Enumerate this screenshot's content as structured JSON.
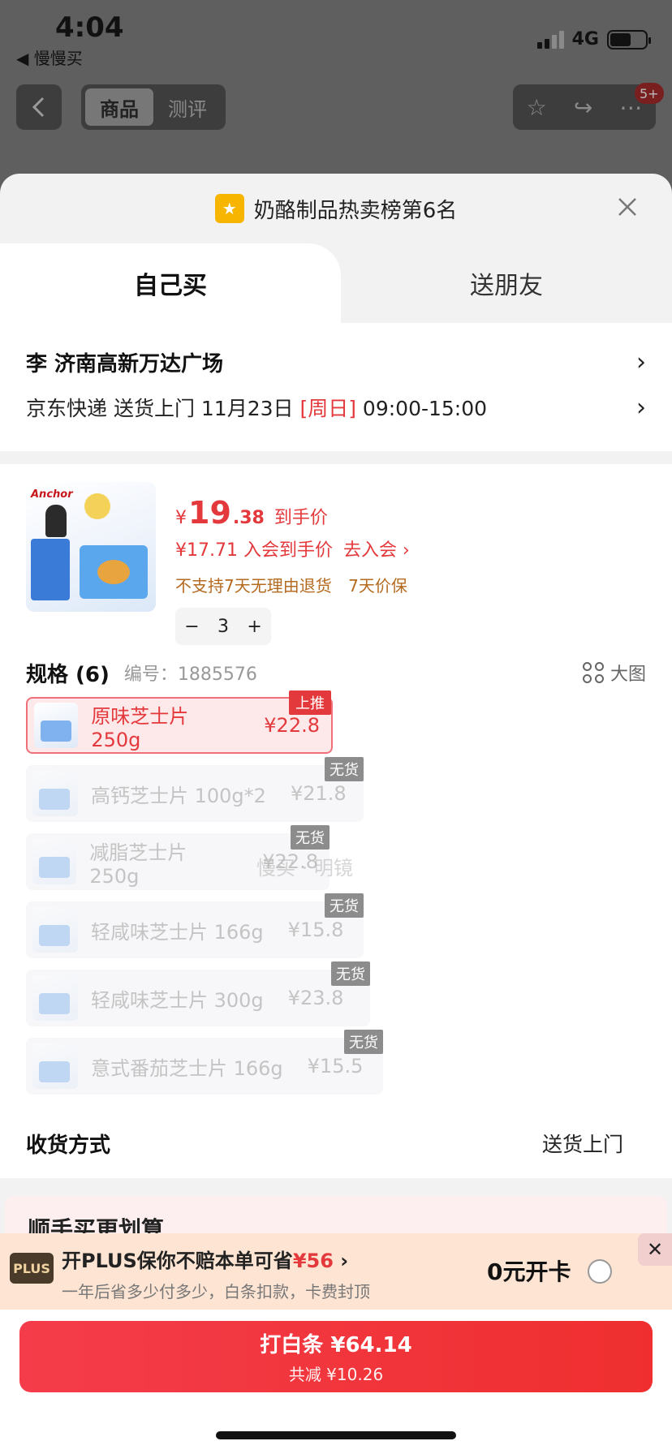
{
  "status": {
    "time": "4:04",
    "back_app": "◀ 慢慢买",
    "network": "4G"
  },
  "nav": {
    "tabs": [
      "商品",
      "测评"
    ],
    "badge": "5+"
  },
  "sheet": {
    "rank_text": "奶酪制品热卖榜第6名",
    "tabs": {
      "self": "自己买",
      "friend": "送朋友"
    },
    "address": {
      "name": "李  济南高新万达广场"
    },
    "delivery": {
      "prefix": "京东快递 送货上门 11月23日 ",
      "day": "[周日]",
      "time": " 09:00-15:00"
    },
    "product": {
      "price_yen": "¥",
      "price_int": "19",
      "price_dec": ".38",
      "price_tag": "到手价",
      "member_price": "¥17.71 入会到手价",
      "member_link": "去入会 ›",
      "policy_1": "不支持7天无理由退货",
      "policy_2": "7天价保",
      "quantity": "3",
      "image_logo": "Anchor"
    },
    "spec": {
      "title": "规格 (6)",
      "number": "编号：1885576",
      "big_image": "大图",
      "items": [
        {
          "name": "原味芝士片 250g",
          "price": "¥22.8",
          "tag": "上推",
          "available": true
        },
        {
          "name": "高钙芝士片 100g*2",
          "price": "¥21.8",
          "tag": "无货",
          "available": false
        },
        {
          "name": "减脂芝士片 250g",
          "price": "¥22.8",
          "tag": "无货",
          "available": false
        },
        {
          "name": "轻咸味芝士片 166g",
          "price": "¥15.8",
          "tag": "无货",
          "available": false
        },
        {
          "name": "轻咸味芝士片 300g",
          "price": "¥23.8",
          "tag": "无货",
          "available": false
        },
        {
          "name": "意式番茄芝士片 166g",
          "price": "¥15.5",
          "tag": "无货",
          "available": false
        }
      ],
      "watermark": "慢买 · 明镜"
    },
    "shipping": {
      "label": "收货方式",
      "value": "送货上门"
    },
    "promo_title": "顺手买更划算"
  },
  "plus": {
    "logo": "PLUS",
    "main": "开PLUS保你不赔本单可省",
    "amount": "¥56",
    "sub": "一年后省多少付多少，白条扣款，卡费封顶",
    "open": "0元开卡"
  },
  "pay": {
    "main": "打白条 ¥64.14",
    "sub": "共减 ¥10.26"
  },
  "colors": {
    "accent": "#e4393c",
    "policy": "#b46a1f",
    "plus_bg": "#fde4d3"
  }
}
